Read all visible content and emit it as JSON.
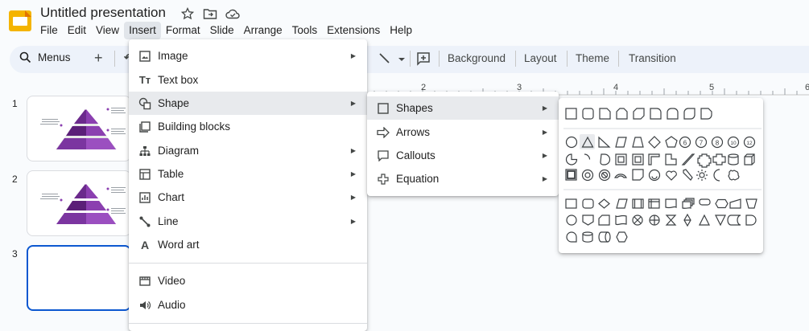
{
  "app": {
    "title": "Untitled presentation"
  },
  "menubar": [
    "File",
    "Edit",
    "View",
    "Insert",
    "Format",
    "Slide",
    "Arrange",
    "Tools",
    "Extensions",
    "Help"
  ],
  "toolbar": {
    "search_label": "Menus",
    "background_label": "Background",
    "layout_label": "Layout",
    "theme_label": "Theme",
    "transition_label": "Transition"
  },
  "ruler": {
    "ticks": [
      "2",
      "3",
      "4",
      "5",
      "6"
    ]
  },
  "slides": [
    "1",
    "2",
    "3"
  ],
  "insert_menu": {
    "items": [
      {
        "label": "Image",
        "icon": "image-icon",
        "submenu": true
      },
      {
        "label": "Text box",
        "icon": "text-box-icon",
        "submenu": false
      },
      {
        "label": "Shape",
        "icon": "shape-icon",
        "submenu": true
      },
      {
        "label": "Building blocks",
        "icon": "building-blocks-icon",
        "submenu": false
      },
      {
        "label": "Diagram",
        "icon": "diagram-icon",
        "submenu": true
      },
      {
        "label": "Table",
        "icon": "table-icon",
        "submenu": true
      },
      {
        "label": "Chart",
        "icon": "chart-icon",
        "submenu": true
      },
      {
        "label": "Line",
        "icon": "line-icon",
        "submenu": true
      },
      {
        "label": "Word art",
        "icon": "word-art-icon",
        "submenu": false
      },
      {
        "label": "Video",
        "icon": "video-icon",
        "submenu": false
      },
      {
        "label": "Audio",
        "icon": "audio-icon",
        "submenu": false
      }
    ]
  },
  "shape_menu": {
    "items": [
      {
        "label": "Shapes",
        "icon": "square-icon"
      },
      {
        "label": "Arrows",
        "icon": "arrow-icon"
      },
      {
        "label": "Callouts",
        "icon": "callout-icon"
      },
      {
        "label": "Equation",
        "icon": "plus-icon"
      }
    ]
  },
  "colors": {
    "accent": "#0b57d0",
    "logo": "#f4b400",
    "pyramid_dark": "#5b1f78",
    "pyramid_light": "#8b3fb0"
  }
}
